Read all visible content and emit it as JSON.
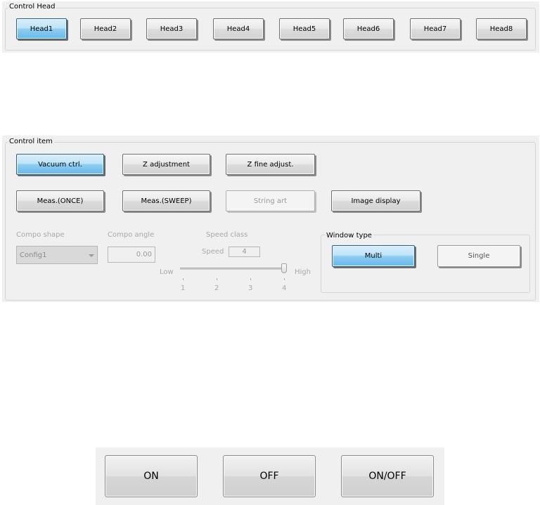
{
  "control_head": {
    "title": "Control Head",
    "heads": [
      {
        "label": "Head1",
        "active": true
      },
      {
        "label": "Head2",
        "active": false
      },
      {
        "label": "Head3",
        "active": false
      },
      {
        "label": "Head4",
        "active": false
      },
      {
        "label": "Head5",
        "active": false
      },
      {
        "label": "Head6",
        "active": false
      },
      {
        "label": "Head7",
        "active": false
      },
      {
        "label": "Head8",
        "active": false
      }
    ]
  },
  "control_item": {
    "title": "Control item",
    "vacuum_label": "Vacuum ctrl.",
    "z_adjust_label": "Z adjustment",
    "z_fine_label": "Z fine adjust.",
    "meas_once_label": "Meas.(ONCE)",
    "meas_sweep_label": "Meas.(SWEEP)",
    "string_art_label": "String art",
    "image_display_label": "Image display",
    "compo_shape_label": "Compo shape",
    "compo_shape_value": "Config1",
    "compo_angle_label": "Compo angle",
    "compo_angle_value": "0.00",
    "speed_class_label": "Speed class",
    "speed_label": "Speed",
    "speed_value": "4",
    "slider_low": "Low",
    "slider_high": "High",
    "slider_ticks": [
      "1",
      "2",
      "3",
      "4"
    ],
    "slider_level": 4,
    "window_type": {
      "title": "Window type",
      "multi_label": "Multi",
      "single_label": "Single",
      "selected": "Multi"
    }
  },
  "power": {
    "on_label": "ON",
    "off_label": "OFF",
    "onoff_label": "ON/OFF"
  },
  "colors": {
    "active_button": "#67b8ea",
    "panel_bg": "#f0f0f0"
  }
}
